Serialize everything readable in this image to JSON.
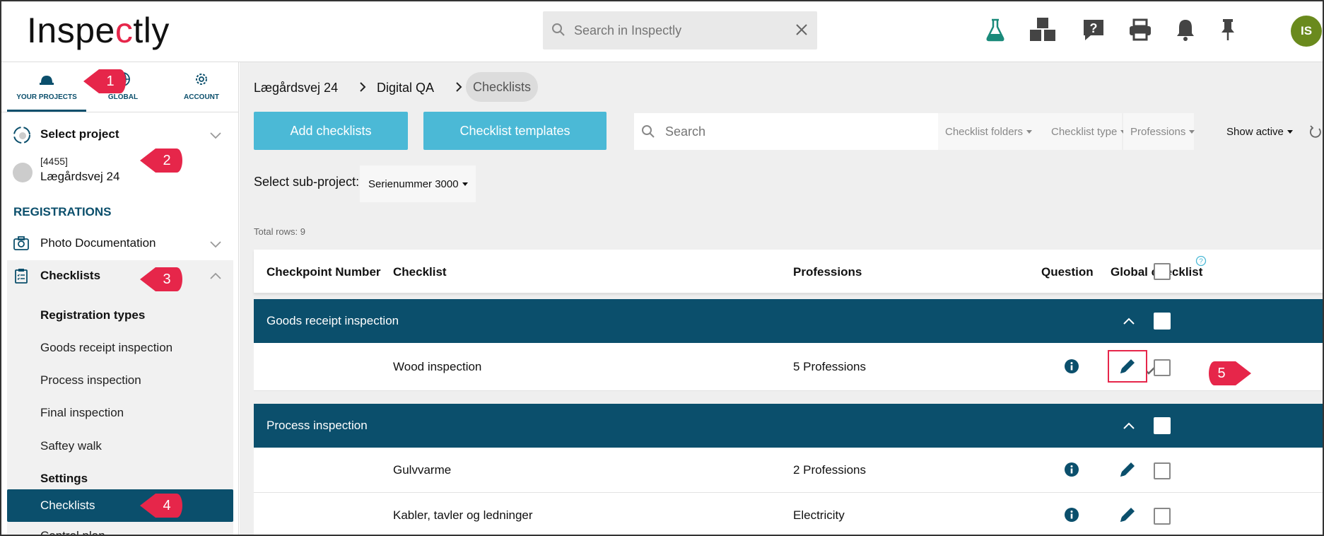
{
  "app": {
    "logo_prefix": "Inspe",
    "logo_mark": "c",
    "logo_suffix": "tly"
  },
  "topbar": {
    "search_placeholder": "Search in Inspectly",
    "icons": [
      "flask-icon",
      "cubes-icon",
      "help-icon",
      "print-icon",
      "bell-icon",
      "pin-icon"
    ],
    "avatar_initials": "IS",
    "avatar_color": "#6a8a1d"
  },
  "sidebar": {
    "tabs": [
      {
        "label": "YOUR PROJECTS",
        "icon": "hard-hat-icon",
        "active": true
      },
      {
        "label": "GLOBAL",
        "icon": "globe-icon",
        "active": false
      },
      {
        "label": "ACCOUNT",
        "icon": "gear-icon",
        "active": false
      }
    ],
    "select_project": "Select project",
    "project_number": "[4455]",
    "project_name": "Lægårdsvej 24",
    "registrations_header": "REGISTRATIONS",
    "photo_documentation": "Photo Documentation",
    "checklists": "Checklists",
    "registration_types_header": "Registration types",
    "registration_types": [
      "Goods receipt inspection",
      "Process inspection",
      "Final inspection",
      "Saftey walk"
    ],
    "settings_header": "Settings",
    "settings_active": "Checklists",
    "cut_item": "Control plan"
  },
  "markers": [
    "1",
    "2",
    "3",
    "4",
    "5"
  ],
  "main": {
    "breadcrumbs": [
      "Lægårdsvej 24",
      "Digital QA",
      "Checklists"
    ],
    "add_checklists": "Add checklists",
    "checklist_templates": "Checklist templates",
    "search_placeholder": "Search",
    "filters": [
      "Checklist folders",
      "Checklist type",
      "Professions",
      "Show active"
    ],
    "subproject_label": "Select sub-project:",
    "subproject_value": "Serienummer 3000",
    "total_rows": "Total rows: 9",
    "columns": {
      "checkpoint_number": "Checkpoint Number",
      "checklist": "Checklist",
      "professions": "Professions",
      "question": "Question",
      "global_checklist": "Global checklist"
    },
    "groups": [
      {
        "name": "Goods receipt inspection",
        "rows": [
          {
            "checklist": "Wood inspection",
            "professions": "5 Professions",
            "global": true
          }
        ]
      },
      {
        "name": "Process inspection",
        "rows": [
          {
            "checklist": "Gulvvarme",
            "professions": "2 Professions",
            "global": false
          },
          {
            "checklist": "Kabler, tavler og ledninger",
            "professions": "Electricity",
            "global": false
          }
        ]
      }
    ],
    "accent": "#4bb9d6",
    "primary": "#0b4f6c",
    "marker_color": "#e6264a"
  }
}
